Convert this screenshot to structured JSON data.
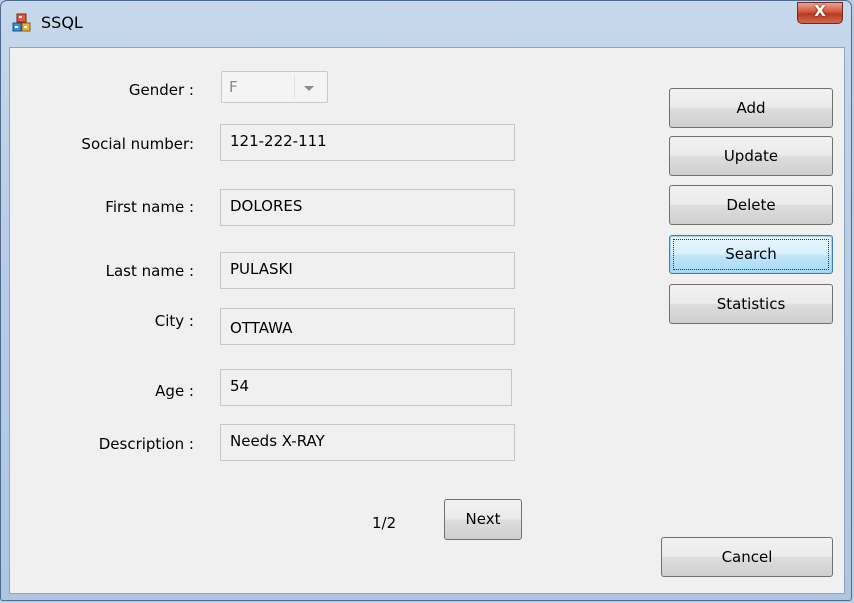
{
  "window": {
    "title": "SSQL",
    "close_symbol": "X"
  },
  "form": {
    "gender": {
      "label": "Gender :",
      "value": "F"
    },
    "social_number": {
      "label": "Social number:",
      "value": "121-222-111"
    },
    "first_name": {
      "label": "First name :",
      "value": "DOLORES"
    },
    "last_name": {
      "label": "Last name :",
      "value": "PULASKI"
    },
    "city": {
      "label": "City :",
      "value": "OTTAWA"
    },
    "age": {
      "label": "Age :",
      "value": "54"
    },
    "description": {
      "label": "Description :",
      "value": "Needs X-RAY"
    }
  },
  "actions": {
    "add": "Add",
    "update": "Update",
    "delete": "Delete",
    "search": "Search",
    "statistics": "Statistics",
    "cancel": "Cancel"
  },
  "pager": {
    "position": "1/2",
    "next": "Next"
  },
  "colors": {
    "focus_border": "#3c7fb1",
    "close_button": "#c8462c"
  },
  "icons": {
    "app": "app-blocks-icon",
    "close": "close-icon",
    "dropdown": "chevron-down-icon"
  }
}
